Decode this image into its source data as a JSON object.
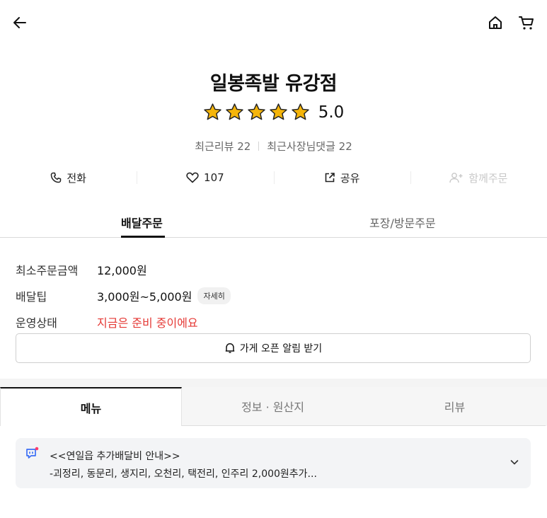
{
  "header": {
    "back_icon": "arrow-left-icon",
    "home_icon": "home-icon",
    "cart_icon": "cart-icon"
  },
  "store": {
    "name": "일봉족발 유강점",
    "rating": "5.0",
    "rating_stars": 5,
    "recent_reviews": "최근리뷰 22",
    "recent_owner_replies": "최근사장님댓글 22"
  },
  "actions": {
    "call": "전화",
    "like_count": "107",
    "share": "공유",
    "group_order": "함께주문"
  },
  "order_tabs": {
    "delivery": "배달주문",
    "pickup": "포장/방문주문"
  },
  "info": {
    "min_order_label": "최소주문금액",
    "min_order_value": "12,000원",
    "delivery_tip_label": "배달팁",
    "delivery_tip_value": "3,000원~5,000원",
    "delivery_tip_detail": "자세히",
    "status_label": "운영상태",
    "status_value": "지금은 준비 중이에요"
  },
  "notify_button": "가게 오픈 알림 받기",
  "main_tabs": {
    "menu": "메뉴",
    "info": "정보 · 원산지",
    "review": "리뷰"
  },
  "notice": {
    "title": "<<연일읍 추가배달비 안내>>",
    "text": "-괴정리, 동문리, 생지리, 오천리, 택전리, 인주리 2,000원추가..."
  },
  "colors": {
    "star": "#f5b50a",
    "status_red": "#e53935",
    "notice_icon": "#3b6ef5",
    "notice_dot": "#ff3b6b"
  }
}
